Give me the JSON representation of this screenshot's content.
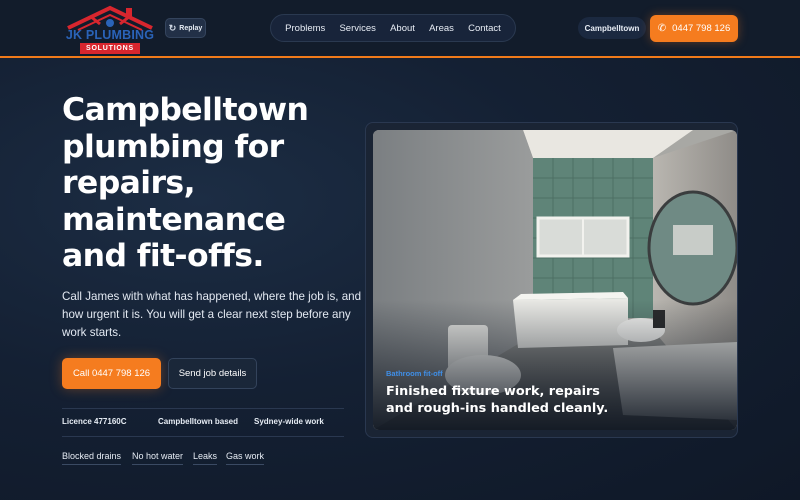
{
  "brand": {
    "logo_text": "JK PLUMBING",
    "logo_sub": "SOLUTIONS",
    "colors": {
      "accent": "#f57c1f",
      "logo_blue": "#2a63b8",
      "logo_red": "#d8262e"
    }
  },
  "header": {
    "replay_label": "Replay",
    "replay_icon": "replay-icon",
    "nav": [
      "Problems",
      "Services",
      "About",
      "Areas",
      "Contact"
    ],
    "location_badge": "Campbelltown",
    "call_label": "0447 798 126",
    "call_icon": "phone-icon"
  },
  "hero": {
    "title": "Campbelltown plumbing for repairs, maintenance and fit-offs.",
    "copy": "Call James with what has happened, where the job is, and how urgent it is. You will get a clear next step before any work starts.",
    "primary_button": "Call 0447 798 126",
    "secondary_button": "Send job details",
    "facts": [
      "Licence 477160C",
      "Campbelltown based",
      "Sydney-wide work"
    ],
    "tags": [
      "Blocked drains",
      "No hot water",
      "Leaks",
      "Gas work"
    ]
  },
  "feature": {
    "tag": "Bathroom fit-off",
    "caption": "Finished fixture work, repairs and rough-ins handled cleanly."
  }
}
